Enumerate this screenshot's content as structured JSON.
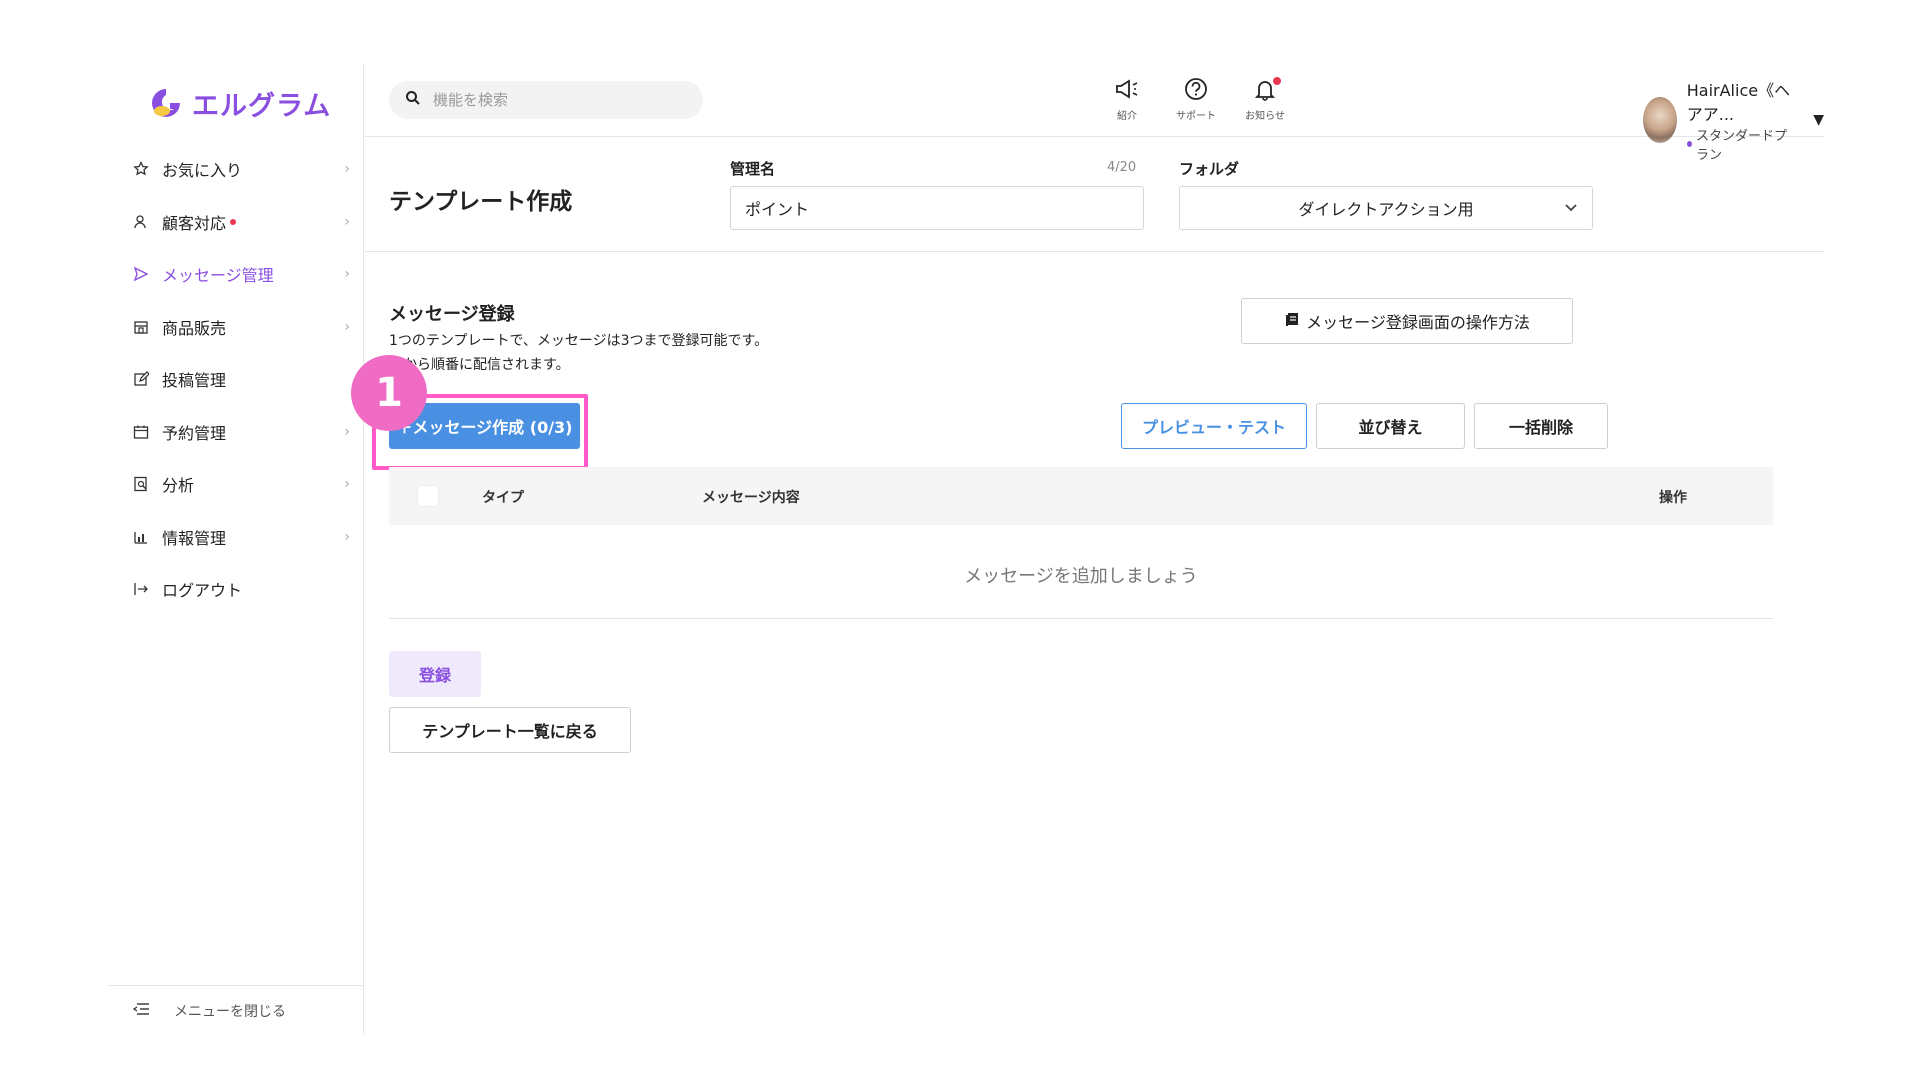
{
  "app": {
    "logo_text": "エルグラム",
    "brand_color": "#8a4fe0"
  },
  "sidebar": {
    "items": [
      {
        "label": "お気に入り",
        "icon": "star-icon"
      },
      {
        "label": "顧客対応",
        "icon": "user-icon",
        "dot": true
      },
      {
        "label": "メッセージ管理",
        "icon": "send-icon",
        "active": true
      },
      {
        "label": "商品販売",
        "icon": "shop-icon"
      },
      {
        "label": "投稿管理",
        "icon": "edit-icon"
      },
      {
        "label": "予約管理",
        "icon": "calendar-icon"
      },
      {
        "label": "分析",
        "icon": "report-icon"
      },
      {
        "label": "情報管理",
        "icon": "chart-icon"
      },
      {
        "label": "ログアウト",
        "icon": "logout-icon"
      }
    ],
    "footer_label": "メニューを閉じる"
  },
  "header": {
    "search_placeholder": "機能を検索",
    "icons": [
      {
        "label": "紹介",
        "icon": "megaphone-icon"
      },
      {
        "label": "サポート",
        "icon": "help-icon"
      },
      {
        "label": "お知らせ",
        "icon": "bell-icon"
      }
    ],
    "user": {
      "name": "HairAlice《ヘアア...",
      "plan": "スタンダードプラン"
    }
  },
  "titlebar": {
    "page_title": "テンプレート作成",
    "name_label": "管理名",
    "name_counter": "4/20",
    "name_value": "ポイント",
    "folder_label": "フォルダ",
    "folder_value": "ダイレクトアクション用"
  },
  "main": {
    "section_title": "メッセージ登録",
    "desc_line1": "1つのテンプレートで、メッセージは3つまで登録可能です。",
    "desc_line2": "上から順番に配信されます。",
    "help_button": "メッセージ登録画面の操作方法",
    "create_button": "＋メッセージ作成 (0/3)",
    "preview_button": "プレビュー・テスト",
    "sort_button": "並び替え",
    "delete_button": "一括削除",
    "table_headers": {
      "type": "タイプ",
      "content": "メッセージ内容",
      "action": "操作"
    },
    "empty_message": "メッセージを追加しましょう",
    "register_button": "登録",
    "back_button": "テンプレート一覧に戻る",
    "annotation_number": "1",
    "accent_blue": "#4a90e2",
    "highlight_pink": "#ff5ac8"
  }
}
